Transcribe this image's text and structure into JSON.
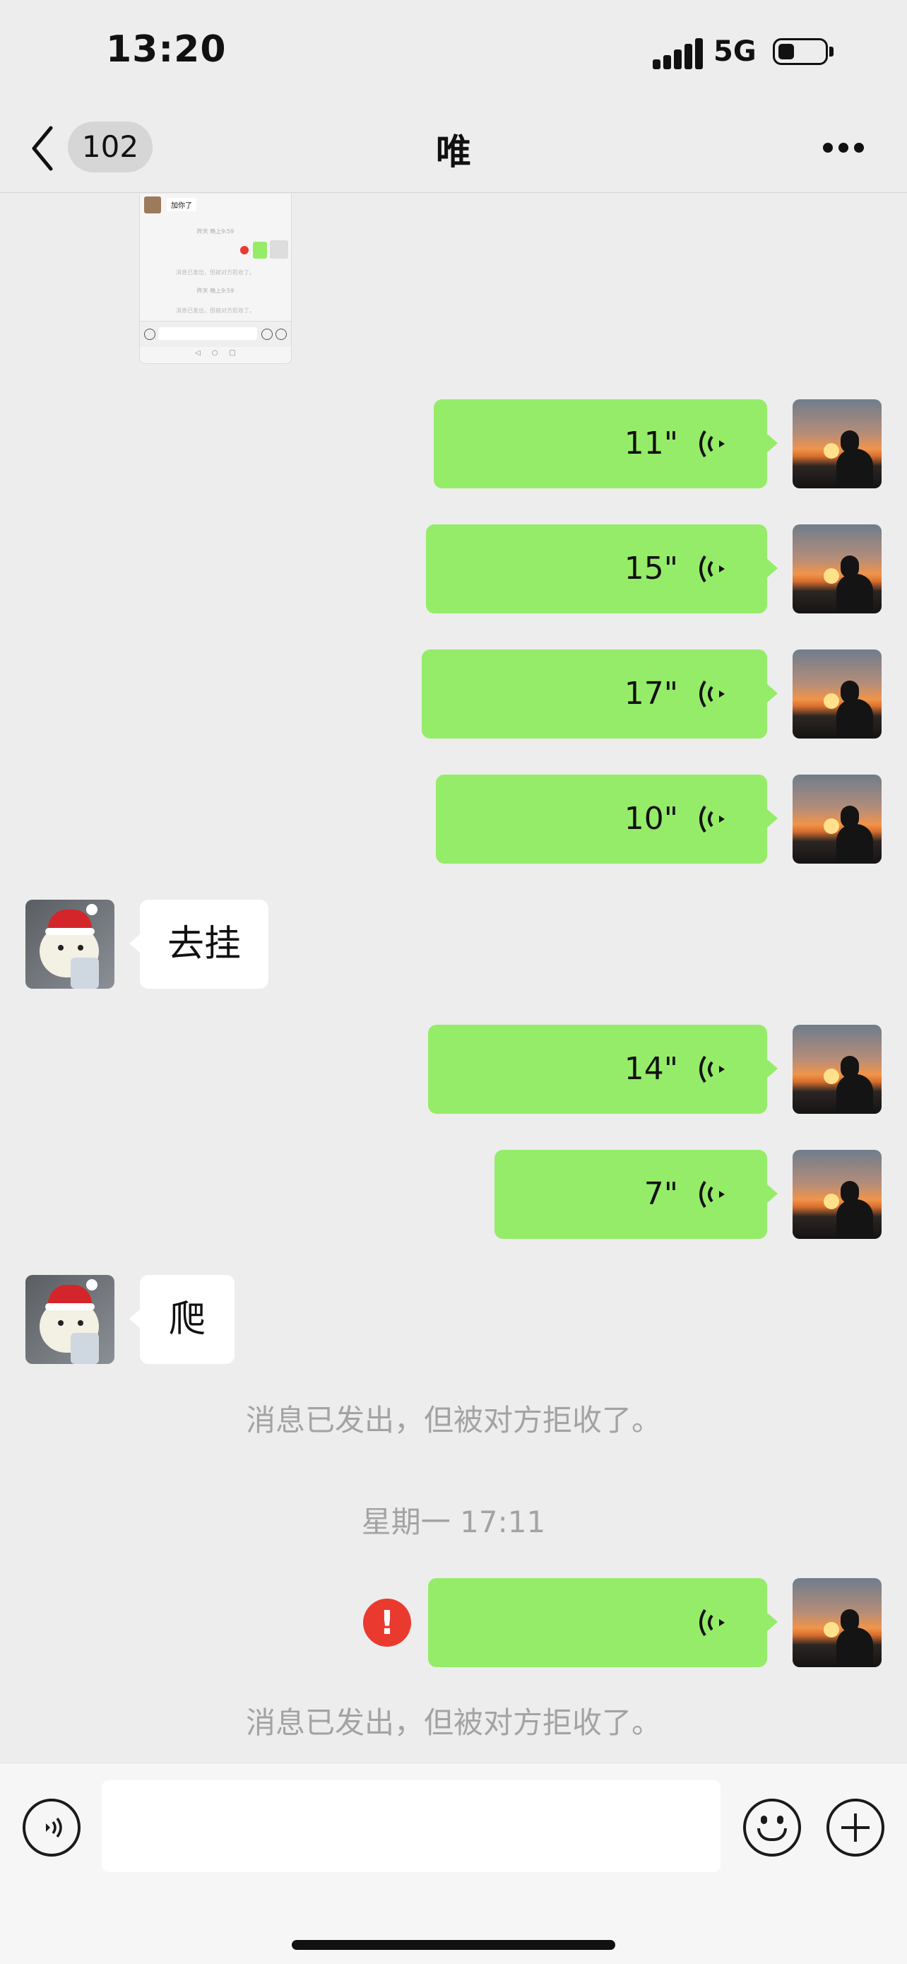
{
  "status": {
    "time": "13:20",
    "network": "5G"
  },
  "nav": {
    "back_count": "102",
    "title": "唯"
  },
  "shot_thumb": {
    "text1": "加你了",
    "time1": "昨天 晚上9:59",
    "rejected1": "消息已发出，但被对方拒收了。",
    "time2": "昨天 晚上9:59",
    "rejected2": "消息已发出，但被对方拒收了。"
  },
  "messages": {
    "voice_durations": [
      "11\"",
      "15\"",
      "17\"",
      "10\"",
      "14\"",
      "7\""
    ],
    "texts": [
      "去挂",
      "爬"
    ]
  },
  "system": {
    "rejected": "消息已发出，但被对方拒收了。",
    "timestamp": "星期一 17:11",
    "rejected2": "消息已发出，但被对方拒收了。",
    "error_mark": "!"
  },
  "colors": {
    "my_bubble": "#95ec69",
    "their_bubble": "#ffffff",
    "error": "#ea3a30",
    "background": "#ededed"
  },
  "icons": [
    "back-icon",
    "more-icon",
    "voice-wave-icon",
    "voice-input-icon",
    "emoji-icon",
    "plus-icon"
  ]
}
